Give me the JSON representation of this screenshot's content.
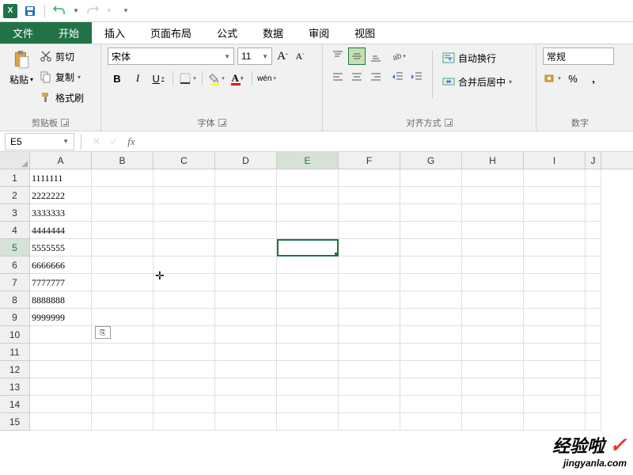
{
  "qat": {
    "excel_abbrev": "X"
  },
  "tabs": {
    "file": "文件",
    "home": "开始",
    "insert": "插入",
    "layout": "页面布局",
    "formulas": "公式",
    "data": "数据",
    "review": "审阅",
    "view": "视图"
  },
  "clipboard": {
    "paste": "粘贴",
    "cut": "剪切",
    "copy": "复制",
    "format_painter": "格式刷",
    "group_label": "剪贴板"
  },
  "font": {
    "name": "宋体",
    "size": "11",
    "bold": "B",
    "italic": "I",
    "underline": "U",
    "pinyin": "wén",
    "group_label": "字体",
    "grow_A": "A",
    "shrink_A": "A"
  },
  "alignment": {
    "wrap": "自动换行",
    "merge": "合并后居中",
    "group_label": "对齐方式"
  },
  "number": {
    "format": "常规",
    "percent": "%",
    "comma": ",",
    "group_label": "数字"
  },
  "formula_bar": {
    "cell_ref": "E5",
    "fx": "fx",
    "value": ""
  },
  "columns": [
    "A",
    "B",
    "C",
    "D",
    "E",
    "F",
    "G",
    "H",
    "I",
    "J"
  ],
  "rows": [
    {
      "n": "1",
      "cells": [
        "1111111",
        "",
        "",
        "",
        "",
        "",
        "",
        "",
        "",
        ""
      ]
    },
    {
      "n": "2",
      "cells": [
        "2222222",
        "",
        "",
        "",
        "",
        "",
        "",
        "",
        "",
        ""
      ]
    },
    {
      "n": "3",
      "cells": [
        "3333333",
        "",
        "",
        "",
        "",
        "",
        "",
        "",
        "",
        ""
      ]
    },
    {
      "n": "4",
      "cells": [
        "4444444",
        "",
        "",
        "",
        "",
        "",
        "",
        "",
        "",
        ""
      ]
    },
    {
      "n": "5",
      "cells": [
        "5555555",
        "",
        "",
        "",
        "",
        "",
        "",
        "",
        "",
        ""
      ]
    },
    {
      "n": "6",
      "cells": [
        "6666666",
        "",
        "",
        "",
        "",
        "",
        "",
        "",
        "",
        ""
      ]
    },
    {
      "n": "7",
      "cells": [
        "7777777",
        "",
        "",
        "",
        "",
        "",
        "",
        "",
        "",
        ""
      ]
    },
    {
      "n": "8",
      "cells": [
        "8888888",
        "",
        "",
        "",
        "",
        "",
        "",
        "",
        "",
        ""
      ]
    },
    {
      "n": "9",
      "cells": [
        "9999999",
        "",
        "",
        "",
        "",
        "",
        "",
        "",
        "",
        ""
      ]
    },
    {
      "n": "10",
      "cells": [
        "",
        "",
        "",
        "",
        "",
        "",
        "",
        "",
        "",
        ""
      ]
    },
    {
      "n": "11",
      "cells": [
        "",
        "",
        "",
        "",
        "",
        "",
        "",
        "",
        "",
        ""
      ]
    },
    {
      "n": "12",
      "cells": [
        "",
        "",
        "",
        "",
        "",
        "",
        "",
        "",
        "",
        ""
      ]
    },
    {
      "n": "13",
      "cells": [
        "",
        "",
        "",
        "",
        "",
        "",
        "",
        "",
        "",
        ""
      ]
    },
    {
      "n": "14",
      "cells": [
        "",
        "",
        "",
        "",
        "",
        "",
        "",
        "",
        "",
        ""
      ]
    },
    {
      "n": "15",
      "cells": [
        "",
        "",
        "",
        "",
        "",
        "",
        "",
        "",
        "",
        ""
      ]
    }
  ],
  "active": {
    "row_index": 4,
    "col_index": 4
  },
  "smart_tag": {
    "label": "⎘"
  },
  "cursor_glyph": "✛",
  "watermark": {
    "line1": "经验啦",
    "check": "✓",
    "line2": "jingyanla.com"
  },
  "colors": {
    "brand": "#217346",
    "fill": "#ffff00",
    "text": "#ff0000"
  }
}
